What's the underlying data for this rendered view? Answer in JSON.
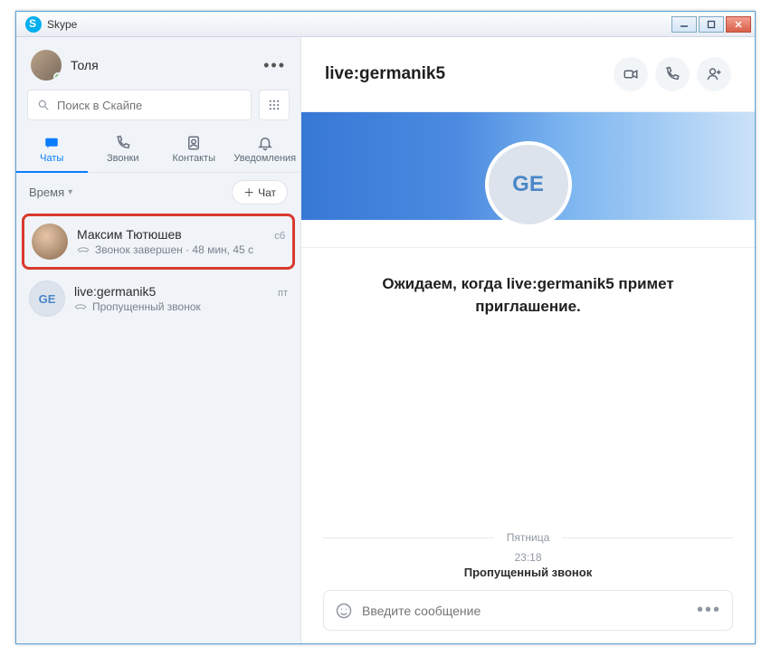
{
  "window": {
    "title": "Skype"
  },
  "sidebar": {
    "username": "Толя",
    "search_placeholder": "Поиск в Скайпе",
    "tabs": {
      "chats": "Чаты",
      "calls": "Звонки",
      "contacts": "Контакты",
      "notifications": "Уведомления"
    },
    "filter_label": "Время",
    "new_chat_label": "Чат",
    "conversations": [
      {
        "name": "Максим Тютюшев",
        "subtitle": "Звонок завершен · 48 мин, 45 с",
        "timestamp": "сб",
        "avatar_initials": ""
      },
      {
        "name": "live:germanik5",
        "subtitle": "Пропущенный звонок",
        "timestamp": "пт",
        "avatar_initials": "GE"
      }
    ]
  },
  "chat": {
    "title": "live:germanik5",
    "avatar_initials": "GE",
    "welcome_text": "Ожидаем, когда live:germanik5 примет приглашение.",
    "day_separator": "Пятница",
    "missed_call": {
      "time": "23:18",
      "label": "Пропущенный звонок"
    },
    "composer_placeholder": "Введите сообщение"
  }
}
